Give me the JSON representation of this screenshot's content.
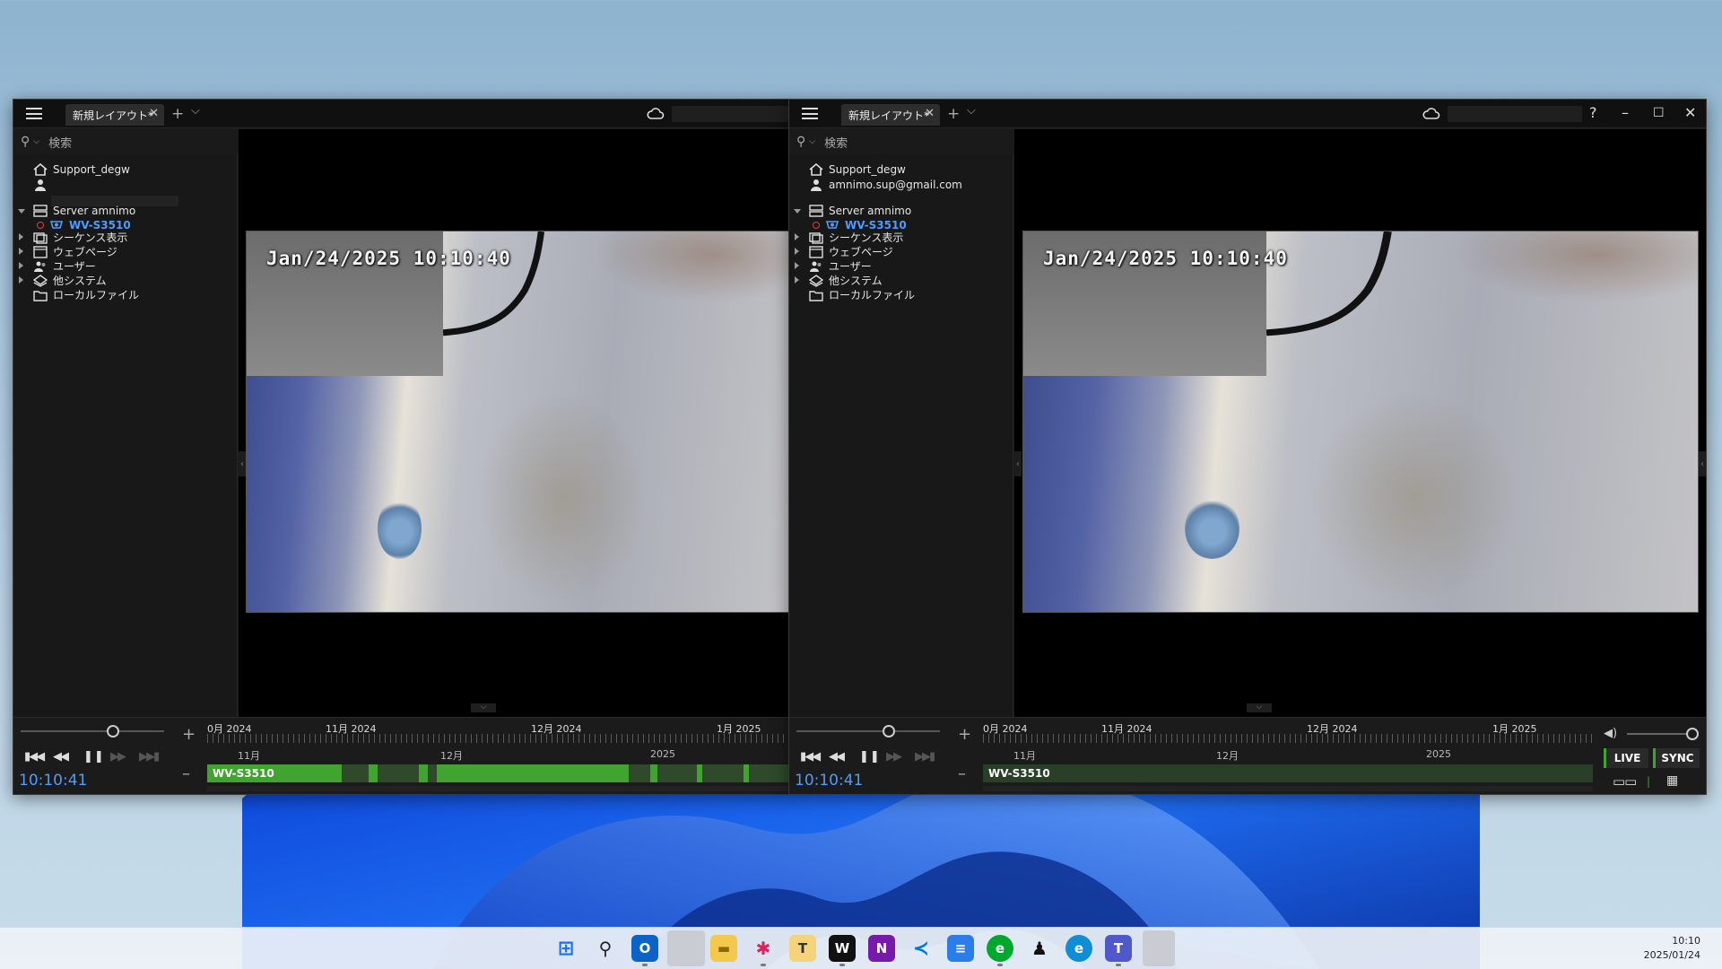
{
  "windows": [
    {
      "tab_label": "新規レイアウト*",
      "search_placeholder": "検索",
      "user_name": "Support_degw",
      "user_email": "",
      "server": "Server amnimo",
      "camera": "WV-S3510",
      "tree": [
        "シーケンス表示",
        "ウェブページ",
        "ユーザー",
        "他システム",
        "ローカルファイル"
      ],
      "osd_timestamp": "Jan/24/2025  10:10:40",
      "months": [
        "0月 2024",
        "11月 2024",
        "12月 2024",
        "1月 2025"
      ],
      "sub_months": [
        "11月",
        "12月",
        "2025"
      ],
      "track_label": "WV-S3510",
      "clock": "10:10:41"
    },
    {
      "tab_label": "新規レイアウト*",
      "search_placeholder": "検索",
      "user_name": "Support_degw",
      "user_email": "amnimo.sup@gmail.com",
      "server": "Server amnimo",
      "camera": "WV-S3510",
      "tree": [
        "シーケンス表示",
        "ウェブページ",
        "ユーザー",
        "他システム",
        "ローカルファイル"
      ],
      "osd_timestamp": "Jan/24/2025  10:10:40",
      "months": [
        "0月 2024",
        "11月 2024",
        "12月 2024",
        "1月 2025"
      ],
      "sub_months": [
        "11月",
        "12月",
        "2025"
      ],
      "track_label": "WV-S3510",
      "clock": "10:10:41",
      "live_label": "LIVE",
      "sync_label": "SYNC"
    }
  ],
  "taskbar": {
    "time": "10:10",
    "date": "2025/01/24",
    "apps": [
      "windows-start",
      "search",
      "outlook",
      "blank",
      "file-explorer",
      "slack",
      "notes-t",
      "word",
      "onenote",
      "vscode",
      "notepad",
      "evernote",
      "linux",
      "edge",
      "teams",
      "blank"
    ]
  },
  "colors": {
    "accent_blue": "#4f9cff",
    "recording_green": "#41a431"
  }
}
